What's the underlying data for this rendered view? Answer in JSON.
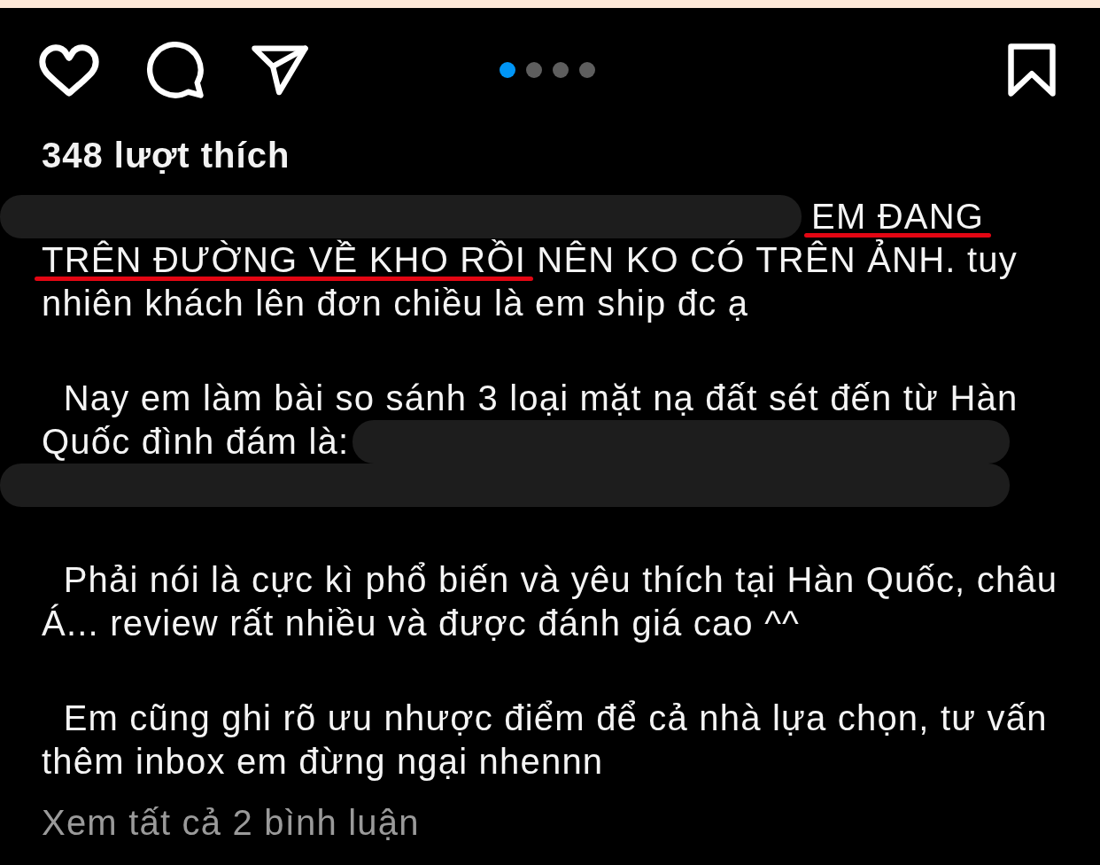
{
  "actions": {
    "liked": false,
    "saved": false
  },
  "carousel": {
    "dots": [
      {
        "selected": true
      },
      {
        "selected": false
      },
      {
        "selected": false
      },
      {
        "selected": false
      }
    ]
  },
  "likes": "348 lượt thích",
  "caption": {
    "paragraphs": [
      {
        "lines": [
          [
            {
              "kind": "blur"
            },
            {
              "kind": "text",
              "text": "EM ĐANG",
              "underlined": true
            }
          ],
          [
            {
              "kind": "text",
              "text": "TRÊN ĐƯỜNG VỀ KHO RỒI",
              "underlined": true
            },
            {
              "kind": "text",
              "text": " NÊN KO CÓ TRÊN ẢNH. tuy",
              "underlined": false
            }
          ],
          [
            {
              "kind": "text",
              "text": "nhiên khách lên đơn chiều là em ship đc ạ",
              "underlined": false
            }
          ]
        ]
      },
      {
        "lines": [
          [
            {
              "kind": "text",
              "text": "  Nay em làm bài so sánh 3 loại mặt nạ đất sét đến từ Hàn",
              "underlined": false
            }
          ],
          [
            {
              "kind": "text",
              "text": "Quốc đình đám là:",
              "underlined": false
            },
            {
              "kind": "blur"
            }
          ],
          [
            {
              "kind": "blur"
            }
          ]
        ]
      },
      {
        "lines": [
          [
            {
              "kind": "text",
              "text": "  Phải nói là cực kì phổ biến và yêu thích tại Hàn Quốc, châu",
              "underlined": false
            }
          ],
          [
            {
              "kind": "text",
              "text": "Á... review rất nhiều và được đánh giá cao ^^",
              "underlined": false
            }
          ]
        ]
      },
      {
        "lines": [
          [
            {
              "kind": "text",
              "text": "  Em cũng ghi rõ ưu nhược điểm để cả nhà lựa chọn, tư vấn",
              "underlined": false
            }
          ],
          [
            {
              "kind": "text",
              "text": "thêm inbox em đừng ngại nhennn",
              "underlined": false
            }
          ]
        ]
      }
    ]
  },
  "view_comments": "Xem tất cả 2 bình luận"
}
